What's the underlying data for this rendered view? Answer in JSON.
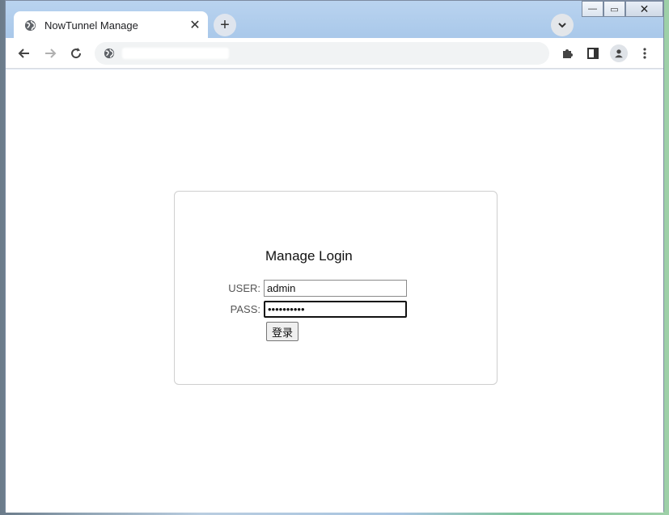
{
  "browser": {
    "tab_title": "NowTunnel Manage",
    "tab_close": "✕",
    "new_tab": "+",
    "window_minimize": "—",
    "window_restore": "▭",
    "window_close": "✕"
  },
  "login": {
    "title": "Manage Login",
    "user_label": "USER:",
    "user_value": "admin",
    "pass_label": "PASS:",
    "pass_value": "••••••••••",
    "submit_label": "登录"
  },
  "icons": {
    "tab_favicon": "globe-icon",
    "back": "back-arrow-icon",
    "forward": "forward-arrow-icon",
    "reload": "reload-icon",
    "site_info": "globe-icon",
    "extensions": "puzzle-icon",
    "side_panel": "side-panel-icon",
    "profile": "profile-icon",
    "menu": "kebab-menu-icon",
    "tab_search": "chevron-down-icon"
  }
}
